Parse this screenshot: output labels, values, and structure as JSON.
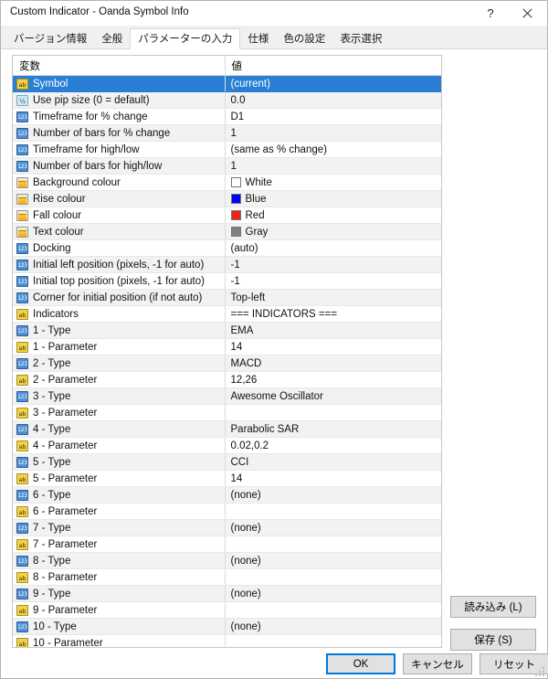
{
  "window": {
    "title": "Custom Indicator - Oanda Symbol Info",
    "help_label": "?",
    "close_label": "✕"
  },
  "tabs": [
    {
      "label": "バージョン情報",
      "name": "tab-version-info",
      "active": false
    },
    {
      "label": "全般",
      "name": "tab-general",
      "active": false
    },
    {
      "label": "パラメーターの入力",
      "name": "tab-parameter-input",
      "active": true
    },
    {
      "label": "仕様",
      "name": "tab-spec",
      "active": false
    },
    {
      "label": "色の設定",
      "name": "tab-colour-settings",
      "active": false
    },
    {
      "label": "表示選択",
      "name": "tab-display-selection",
      "active": false
    }
  ],
  "grid": {
    "columns": [
      {
        "label": "変数",
        "name": "column-header-variable"
      },
      {
        "label": "値",
        "name": "column-header-value"
      }
    ],
    "rows": [
      {
        "icon": "string-icon",
        "icon_type": "string",
        "name": "Symbol",
        "value": "(current)",
        "selected": true
      },
      {
        "icon": "double-icon",
        "icon_type": "double",
        "name": "Use pip size (0 = default)",
        "value": "0.0"
      },
      {
        "icon": "int-icon",
        "icon_type": "int",
        "name": "Timeframe for % change",
        "value": "D1"
      },
      {
        "icon": "int-icon",
        "icon_type": "int",
        "name": "Number of bars for % change",
        "value": "1"
      },
      {
        "icon": "int-icon",
        "icon_type": "int",
        "name": "Timeframe for high/low",
        "value": "(same as % change)"
      },
      {
        "icon": "int-icon",
        "icon_type": "int",
        "name": "Number of bars for high/low",
        "value": "1"
      },
      {
        "icon": "colour-icon",
        "icon_type": "colour",
        "name": "Background colour",
        "value": "White",
        "swatch": "#ffffff"
      },
      {
        "icon": "colour-icon",
        "icon_type": "colour",
        "name": "Rise colour",
        "value": "Blue",
        "swatch": "#0000ff"
      },
      {
        "icon": "colour-icon",
        "icon_type": "colour",
        "name": "Fall colour",
        "value": "Red",
        "swatch": "#f02414"
      },
      {
        "icon": "colour-icon",
        "icon_type": "colour",
        "name": "Text colour",
        "value": "Gray",
        "swatch": "#808080"
      },
      {
        "icon": "int-icon",
        "icon_type": "int",
        "name": "Docking",
        "value": "(auto)"
      },
      {
        "icon": "int-icon",
        "icon_type": "int",
        "name": "Initial left position (pixels, -1 for auto)",
        "value": "-1"
      },
      {
        "icon": "int-icon",
        "icon_type": "int",
        "name": "Initial top position (pixels, -1 for auto)",
        "value": "-1"
      },
      {
        "icon": "int-icon",
        "icon_type": "int",
        "name": "Corner for initial position (if not auto)",
        "value": "Top-left"
      },
      {
        "icon": "string-icon",
        "icon_type": "string",
        "name": "Indicators",
        "value": "=== INDICATORS ==="
      },
      {
        "icon": "int-icon",
        "icon_type": "int",
        "name": "1 - Type",
        "value": "EMA"
      },
      {
        "icon": "string-icon",
        "icon_type": "string",
        "name": "1 - Parameter",
        "value": "14"
      },
      {
        "icon": "int-icon",
        "icon_type": "int",
        "name": "2 - Type",
        "value": "MACD"
      },
      {
        "icon": "string-icon",
        "icon_type": "string",
        "name": "2 - Parameter",
        "value": "12,26"
      },
      {
        "icon": "int-icon",
        "icon_type": "int",
        "name": "3 - Type",
        "value": "Awesome Oscillator"
      },
      {
        "icon": "string-icon",
        "icon_type": "string",
        "name": "3 - Parameter",
        "value": ""
      },
      {
        "icon": "int-icon",
        "icon_type": "int",
        "name": "4 - Type",
        "value": "Parabolic SAR"
      },
      {
        "icon": "string-icon",
        "icon_type": "string",
        "name": "4 - Parameter",
        "value": "0.02,0.2"
      },
      {
        "icon": "int-icon",
        "icon_type": "int",
        "name": "5 - Type",
        "value": "CCI"
      },
      {
        "icon": "string-icon",
        "icon_type": "string",
        "name": "5 - Parameter",
        "value": "14"
      },
      {
        "icon": "int-icon",
        "icon_type": "int",
        "name": "6 - Type",
        "value": "(none)"
      },
      {
        "icon": "string-icon",
        "icon_type": "string",
        "name": "6 - Parameter",
        "value": ""
      },
      {
        "icon": "int-icon",
        "icon_type": "int",
        "name": "7 - Type",
        "value": "(none)"
      },
      {
        "icon": "string-icon",
        "icon_type": "string",
        "name": "7 - Parameter",
        "value": ""
      },
      {
        "icon": "int-icon",
        "icon_type": "int",
        "name": "8 - Type",
        "value": "(none)"
      },
      {
        "icon": "string-icon",
        "icon_type": "string",
        "name": "8 - Parameter",
        "value": ""
      },
      {
        "icon": "int-icon",
        "icon_type": "int",
        "name": "9 - Type",
        "value": "(none)"
      },
      {
        "icon": "string-icon",
        "icon_type": "string",
        "name": "9 - Parameter",
        "value": ""
      },
      {
        "icon": "int-icon",
        "icon_type": "int",
        "name": "10 - Type",
        "value": "(none)"
      },
      {
        "icon": "string-icon",
        "icon_type": "string",
        "name": "10 - Parameter",
        "value": ""
      }
    ],
    "icon_glyphs": {
      "string": "ab",
      "double": "½",
      "int": "123",
      "colour": ""
    }
  },
  "side_buttons": [
    {
      "label": "読み込み (L)",
      "name": "load-button"
    },
    {
      "label": "保存 (S)",
      "name": "save-button"
    }
  ],
  "footer_buttons": [
    {
      "label": "OK",
      "name": "ok-button",
      "default": true
    },
    {
      "label": "キャンセル",
      "name": "cancel-button",
      "default": false
    },
    {
      "label": "リセット",
      "name": "reset-button",
      "default": false
    }
  ],
  "colors": {
    "selection": "#2a7fd4",
    "accent": "#0078d7",
    "window_bg": "#f0f0f0",
    "row_alt": "#f2f2f2"
  }
}
